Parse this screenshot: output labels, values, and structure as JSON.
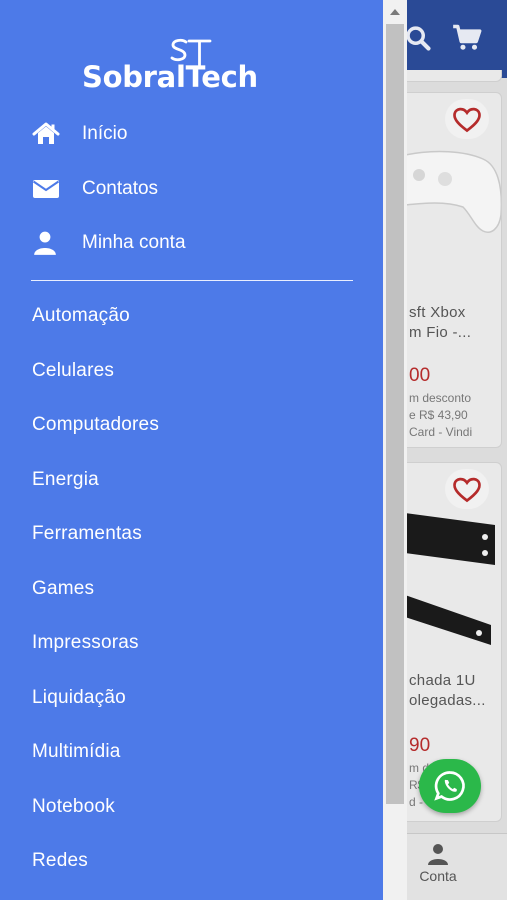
{
  "drawer": {
    "logo": "SobralTech",
    "logo_mark": "ST",
    "nav": [
      {
        "label": "Início",
        "icon": "home-icon"
      },
      {
        "label": "Contatos",
        "icon": "envelope-icon"
      },
      {
        "label": "Minha conta",
        "icon": "user-icon"
      }
    ],
    "categories": [
      "Automação",
      "Celulares",
      "Computadores",
      "Energia",
      "Ferramentas",
      "Games",
      "Impressoras",
      "Liquidação",
      "Multimídia",
      "Notebook",
      "Redes"
    ]
  },
  "background": {
    "card1": {
      "title_line1": "sft Xbox",
      "title_line2": "m Fio -...",
      "price": "00",
      "note_line1": "m desconto",
      "note_line2": "e R$ 43,90",
      "note_line3": "Card - Vindi"
    },
    "card2": {
      "title_line1": "chada 1U",
      "title_line2": "olegadas...",
      "price": "90",
      "note_line1": "m d",
      "note_line2": "R$",
      "note_line3": "d -"
    },
    "bottom_nav": {
      "account_label": "Conta"
    }
  },
  "colors": {
    "drawer": "#4d7ae8",
    "header": "#2a4a96",
    "price": "#b52b2b",
    "whatsapp": "#2bb84a"
  }
}
